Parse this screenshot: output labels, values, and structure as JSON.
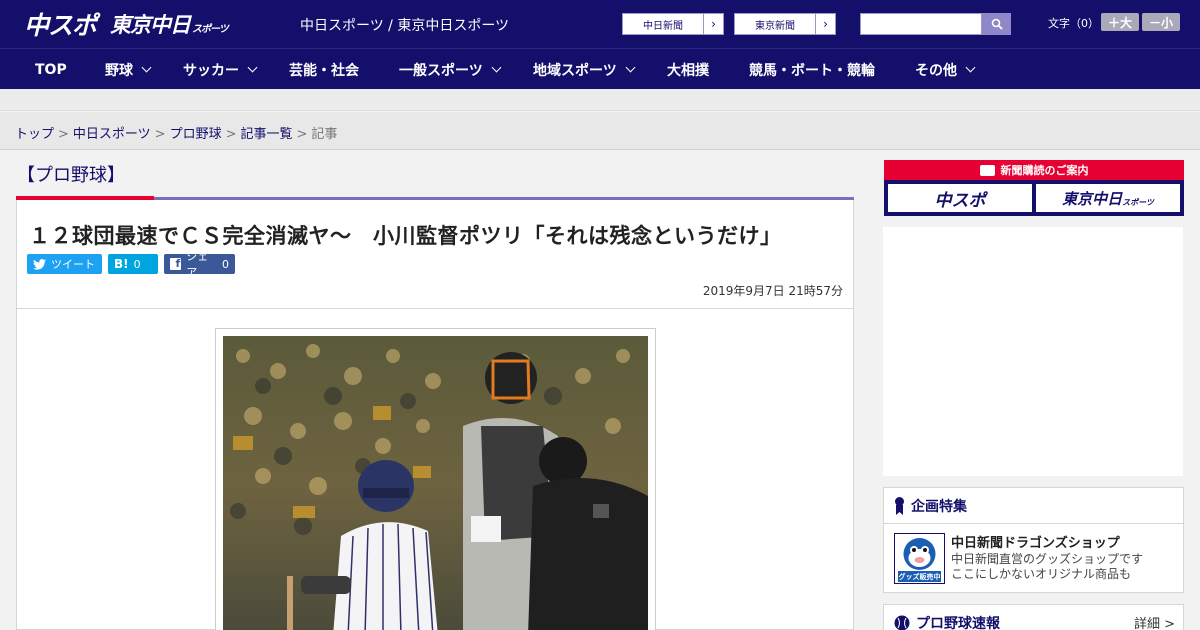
{
  "header": {
    "logo_chuspo": "中スポ",
    "logo_tokyo": "東京中日",
    "logo_tokyo_suffix": "スポーツ",
    "site_names": "中日スポーツ / 東京中日スポーツ",
    "ext_links": [
      "中日新聞",
      "東京新聞"
    ],
    "search_placeholder": "",
    "font_size_label": "文字（0）",
    "font_bigger": "＋大",
    "font_smaller": "－小"
  },
  "nav": {
    "items": [
      {
        "label": "TOP",
        "has_menu": false
      },
      {
        "label": "野球",
        "has_menu": true
      },
      {
        "label": "サッカー",
        "has_menu": true
      },
      {
        "label": "芸能・社会",
        "has_menu": false
      },
      {
        "label": "一般スポーツ",
        "has_menu": true
      },
      {
        "label": "地域スポーツ",
        "has_menu": true
      },
      {
        "label": "大相撲",
        "has_menu": false
      },
      {
        "label": "競馬・ボート・競輪",
        "has_menu": false
      },
      {
        "label": "その他",
        "has_menu": true
      }
    ]
  },
  "breadcrumb": {
    "items": [
      "トップ",
      "中日スポーツ",
      "プロ野球",
      "記事一覧"
    ],
    "current": "記事"
  },
  "article": {
    "category": "【プロ野球】",
    "headline": "１２球団最速でＣＳ完全消滅ヤ～　小川監督ポツリ「それは残念というだけ」",
    "share_twitter": "ツイート",
    "share_hatena_count": "0",
    "share_facebook": "シェア",
    "share_facebook_count": "0",
    "date": "2019年9月7日 21時57分"
  },
  "sidebar": {
    "subscribe_title": "新聞購読のご案内",
    "subscribe_chuspo": "中スポ",
    "subscribe_tokyo": "東京中日",
    "subscribe_tokyo_suffix": "スポーツ",
    "feature_title": "企画特集",
    "shop_title": "中日新聞ドラゴンズショップ",
    "shop_desc_1": "中日新聞直営のグッズショップです",
    "shop_desc_2": "ここにしかないオリジナル商品も",
    "shop_badge": "グッズ販売中",
    "proyakyu_title": "プロ野球速報",
    "proyakyu_more": "詳細 >"
  },
  "colors": {
    "brand_navy": "#140f6b",
    "accent_red": "#e60033",
    "accent_purple": "#7a6fbf",
    "twitter": "#1da1f2",
    "hatena": "#00a4de",
    "facebook": "#3b5998"
  }
}
